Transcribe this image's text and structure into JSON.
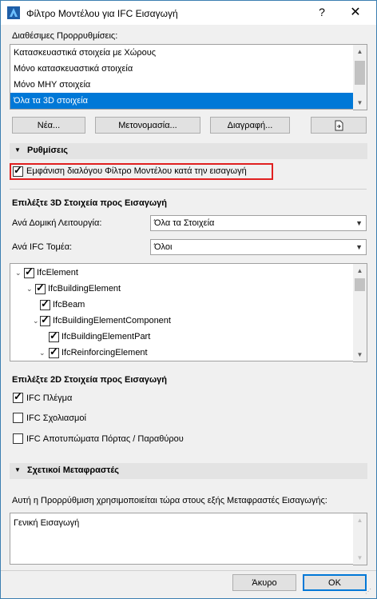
{
  "window": {
    "title": "Φίλτρο Μοντέλου για IFC Εισαγωγή",
    "help": "?",
    "close": "✕",
    "accent": "#0078d7"
  },
  "presets": {
    "label": "Διαθέσιμες Προρρυθμίσεις:",
    "items": [
      "Κατασκευαστικά στοιχεία με Χώρους",
      "Μόνο κατασκευαστικά στοιχεία",
      "Μόνο ΜΗΥ στοιχεία",
      "Όλα τα 3D στοιχεία"
    ],
    "selected_index": 3
  },
  "preset_buttons": {
    "new": "Νέα...",
    "rename": "Μετονομασία...",
    "delete": "Διαγραφή..."
  },
  "settings": {
    "header": "Ρυθμίσεις",
    "show_dialog": "Εμφάνιση διαλόγου Φίλτρο Μοντέλου κατά την εισαγωγή",
    "show_dialog_checked": true
  },
  "elements3d": {
    "header": "Επιλέξτε 3D Στοιχεία προς Εισαγωγή",
    "structural_label": "Ανά Δομική Λειτουργία:",
    "structural_value": "Όλα τα Στοιχεία",
    "domain_label": "Ανά IFC Τομέα:",
    "domain_value": "Όλοι",
    "tree": [
      {
        "label": "IfcElement",
        "twist": true,
        "checked": true
      },
      {
        "label": "IfcBuildingElement",
        "twist": true,
        "checked": true
      },
      {
        "label": "IfcBeam",
        "twist": false,
        "checked": true
      },
      {
        "label": "IfcBuildingElementComponent",
        "twist": true,
        "checked": true
      },
      {
        "label": "IfcBuildingElementPart",
        "twist": false,
        "checked": true
      },
      {
        "label": "IfcReinforcingElement",
        "twist": true,
        "checked": true
      }
    ]
  },
  "elements2d": {
    "header": "Επιλέξτε 2D Στοιχεία προς Εισαγωγή",
    "items": [
      {
        "label": "IFC Πλέγμα",
        "checked": true
      },
      {
        "label": "IFC Σχολιασμοί",
        "checked": false
      },
      {
        "label": "IFC Αποτυπώματα Πόρτας / Παραθύρου",
        "checked": false
      }
    ]
  },
  "translators": {
    "header": "Σχετικοί Μεταφραστές",
    "description": "Αυτή η Προρρύθμιση χρησιμοποιείται τώρα στους εξής Μεταφραστές Εισαγωγής:",
    "items": [
      "Γενική Εισαγωγή"
    ]
  },
  "footer": {
    "cancel": "Άκυρο",
    "ok": "OK"
  }
}
